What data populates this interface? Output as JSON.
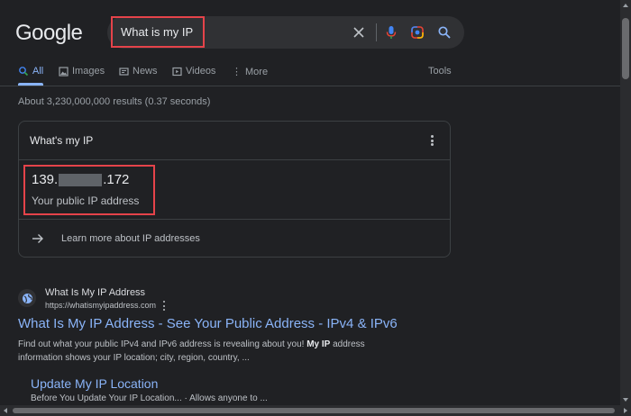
{
  "header": {
    "logo": "Google",
    "search": {
      "query": "What is my IP",
      "icons": [
        "clear-icon",
        "microphone-icon",
        "lens-icon",
        "search-icon"
      ]
    }
  },
  "tabs": [
    {
      "label": "All",
      "icon": "search-icon",
      "active": true
    },
    {
      "label": "Images",
      "icon": "image-icon"
    },
    {
      "label": "News",
      "icon": "news-icon"
    },
    {
      "label": "Videos",
      "icon": "video-icon"
    },
    {
      "label": "More",
      "icon": "more-vertical-icon"
    }
  ],
  "tools_label": "Tools",
  "result_stats": "About 3,230,000,000 results (0.37 seconds)",
  "ip_card": {
    "title": "What's my IP",
    "ip_prefix": "139.",
    "ip_suffix": ".172",
    "ip_caption": "Your public IP address",
    "learn_more": "Learn more about IP addresses"
  },
  "result": {
    "site_name": "What Is My IP Address",
    "url": "https://whatismyipaddress.com",
    "title": "What Is My IP Address - See Your Public Address - IPv4 & IPv6",
    "snippet_parts": [
      "Find out what your public IPv4 and IPv6 address is revealing about you! ",
      "My IP",
      " address information shows your IP location; city, region, country, ..."
    ],
    "sublink_title": "Update My IP Location",
    "sublink_snippet": "Before You Update Your IP Location... · Allows anyone to ..."
  },
  "colors": {
    "background": "#202124",
    "link": "#8ab4f8",
    "highlight_box": "#e5434a",
    "mic_blue": "#4285f4",
    "mic_red": "#ea4335"
  }
}
